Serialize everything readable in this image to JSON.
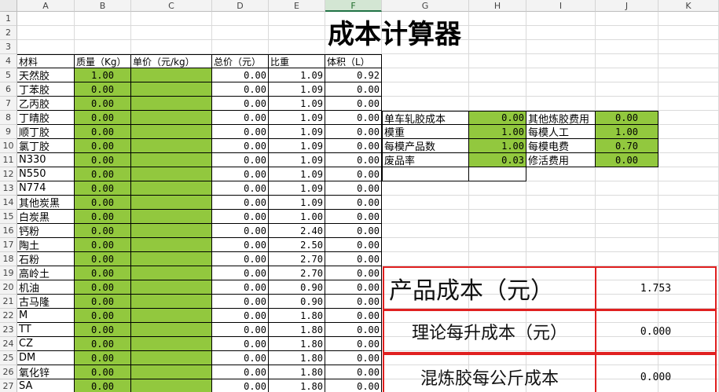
{
  "columns": [
    "A",
    "B",
    "C",
    "D",
    "E",
    "F",
    "G",
    "H",
    "I",
    "J",
    "K"
  ],
  "rows": [
    "1",
    "2",
    "3",
    "4",
    "5",
    "6",
    "7",
    "8",
    "9",
    "10",
    "11",
    "12",
    "13",
    "14",
    "15",
    "16",
    "17",
    "18",
    "19",
    "20",
    "21",
    "22",
    "23",
    "24",
    "25",
    "26",
    "27"
  ],
  "title": "成本计算器",
  "headers": {
    "material": "材料",
    "mass": "质量（Kg）",
    "unit_price": "单价（元/kg）",
    "total_price": "总价（元）",
    "density": "比重",
    "volume": "体积（L）"
  },
  "materials": [
    {
      "name": "天然胶",
      "mass": "1.00",
      "unit_price": "",
      "total": "0.00",
      "density": "1.09",
      "volume": "0.92"
    },
    {
      "name": "丁苯胶",
      "mass": "0.00",
      "unit_price": "",
      "total": "0.00",
      "density": "1.09",
      "volume": "0.00"
    },
    {
      "name": "乙丙胶",
      "mass": "0.00",
      "unit_price": "",
      "total": "0.00",
      "density": "1.09",
      "volume": "0.00"
    },
    {
      "name": "丁晴胶",
      "mass": "0.00",
      "unit_price": "",
      "total": "0.00",
      "density": "1.09",
      "volume": "0.00"
    },
    {
      "name": "顺丁胶",
      "mass": "0.00",
      "unit_price": "",
      "total": "0.00",
      "density": "1.09",
      "volume": "0.00"
    },
    {
      "name": "氯丁胶",
      "mass": "0.00",
      "unit_price": "",
      "total": "0.00",
      "density": "1.09",
      "volume": "0.00"
    },
    {
      "name": "N330",
      "mass": "0.00",
      "unit_price": "",
      "total": "0.00",
      "density": "1.09",
      "volume": "0.00"
    },
    {
      "name": "N550",
      "mass": "0.00",
      "unit_price": "",
      "total": "0.00",
      "density": "1.09",
      "volume": "0.00"
    },
    {
      "name": "N774",
      "mass": "0.00",
      "unit_price": "",
      "total": "0.00",
      "density": "1.09",
      "volume": "0.00"
    },
    {
      "name": "其他炭黑",
      "mass": "0.00",
      "unit_price": "",
      "total": "0.00",
      "density": "1.09",
      "volume": "0.00"
    },
    {
      "name": "白炭黑",
      "mass": "0.00",
      "unit_price": "",
      "total": "0.00",
      "density": "1.00",
      "volume": "0.00"
    },
    {
      "name": "钙粉",
      "mass": "0.00",
      "unit_price": "",
      "total": "0.00",
      "density": "2.40",
      "volume": "0.00"
    },
    {
      "name": "陶土",
      "mass": "0.00",
      "unit_price": "",
      "total": "0.00",
      "density": "2.50",
      "volume": "0.00"
    },
    {
      "name": "石粉",
      "mass": "0.00",
      "unit_price": "",
      "total": "0.00",
      "density": "2.70",
      "volume": "0.00"
    },
    {
      "name": "高岭土",
      "mass": "0.00",
      "unit_price": "",
      "total": "0.00",
      "density": "2.70",
      "volume": "0.00"
    },
    {
      "name": "机油",
      "mass": "0.00",
      "unit_price": "",
      "total": "0.00",
      "density": "0.90",
      "volume": "0.00"
    },
    {
      "name": "古马隆",
      "mass": "0.00",
      "unit_price": "",
      "total": "0.00",
      "density": "0.90",
      "volume": "0.00"
    },
    {
      "name": "M",
      "mass": "0.00",
      "unit_price": "",
      "total": "0.00",
      "density": "1.80",
      "volume": "0.00"
    },
    {
      "name": "TT",
      "mass": "0.00",
      "unit_price": "",
      "total": "0.00",
      "density": "1.80",
      "volume": "0.00"
    },
    {
      "name": "CZ",
      "mass": "0.00",
      "unit_price": "",
      "total": "0.00",
      "density": "1.80",
      "volume": "0.00"
    },
    {
      "name": "DM",
      "mass": "0.00",
      "unit_price": "",
      "total": "0.00",
      "density": "1.80",
      "volume": "0.00"
    },
    {
      "name": "氧化锌",
      "mass": "0.00",
      "unit_price": "",
      "total": "0.00",
      "density": "1.80",
      "volume": "0.00"
    },
    {
      "name": "SA",
      "mass": "0.00",
      "unit_price": "",
      "total": "0.00",
      "density": "1.80",
      "volume": "0.00"
    }
  ],
  "params": [
    {
      "label": "单车轧胶成本",
      "value": "0.00",
      "label2": "其他炼胶费用",
      "value2": "0.00"
    },
    {
      "label": "模重",
      "value": "1.00",
      "label2": "每模人工",
      "value2": "1.00"
    },
    {
      "label": "每模产品数",
      "value": "1.00",
      "label2": "每模电费",
      "value2": "0.70"
    },
    {
      "label": "废品率",
      "value": "0.03",
      "label2": "修活费用",
      "value2": "0.00"
    }
  ],
  "results": [
    {
      "label": "产品成本（元）",
      "value": "1.753"
    },
    {
      "label": "理论每升成本（元）",
      "value": "0.000"
    },
    {
      "label": "混炼胶每公斤成本",
      "value": "0.000"
    }
  ],
  "colors": {
    "input_green": "#92c83e",
    "result_border": "#e02020",
    "selected_col": "#217346"
  }
}
